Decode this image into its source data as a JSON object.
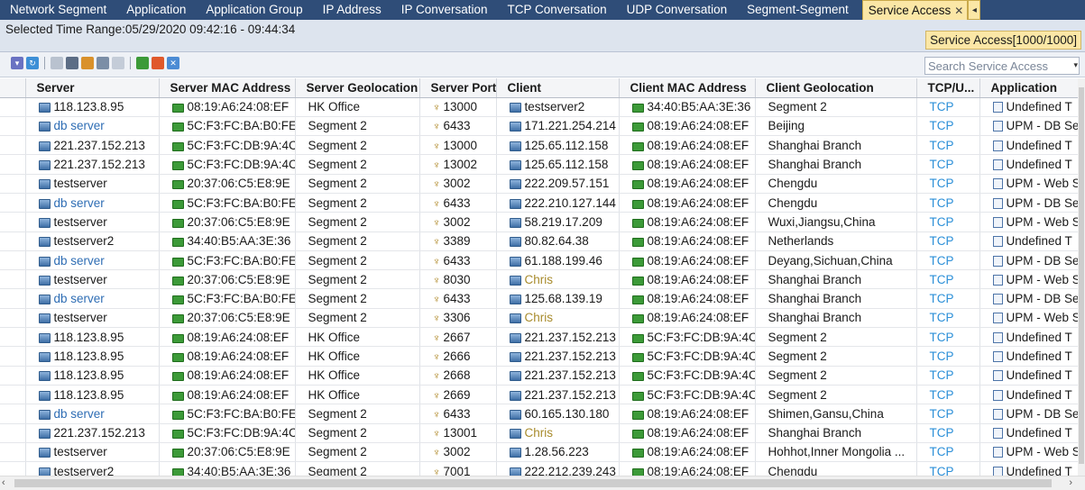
{
  "tabs": [
    {
      "label": "Network Segment",
      "active": false
    },
    {
      "label": "Application",
      "active": false
    },
    {
      "label": "Application Group",
      "active": false
    },
    {
      "label": "IP Address",
      "active": false
    },
    {
      "label": "IP Conversation",
      "active": false
    },
    {
      "label": "TCP Conversation",
      "active": false
    },
    {
      "label": "UDP Conversation",
      "active": false
    },
    {
      "label": "Segment-Segment",
      "active": false
    },
    {
      "label": "Service Access",
      "active": true
    }
  ],
  "info": {
    "time_range": "Selected Time Range:05/29/2020 09:42:16 - 09:44:34",
    "access_count": "Service Access[1000/1000]"
  },
  "search": {
    "placeholder": "Search Service Access"
  },
  "toolbar_icons": [
    "filter-icon",
    "refresh-icon",
    "columns-icon",
    "print-icon",
    "export-icon",
    "chart-icon",
    "settings-icon",
    "grid-icon",
    "pie-chart-icon",
    "clear-icon"
  ],
  "columns": [
    "Server",
    "Server MAC Address",
    "Server Geolocation",
    "Server Port",
    "Client",
    "Client MAC Address",
    "Client Geolocation",
    "TCP/U...",
    "Application"
  ],
  "rows": [
    {
      "server": "118.123.8.95",
      "server_link": false,
      "server_mac": "08:19:A6:24:08:EF",
      "server_geo": "HK Office",
      "port": "13000",
      "client": "testserver2",
      "client_link": "none",
      "client_mac": "34:40:B5:AA:3E:36",
      "client_geo": "Segment 2",
      "proto": "TCP",
      "app": "Undefined T"
    },
    {
      "server": "db server",
      "server_link": true,
      "server_mac": "5C:F3:FC:BA:B0:FE",
      "server_geo": "Segment 2",
      "port": "6433",
      "client": "171.221.254.214",
      "client_link": "none",
      "client_mac": "08:19:A6:24:08:EF",
      "client_geo": "Beijing",
      "proto": "TCP",
      "app": "UPM - DB Se"
    },
    {
      "server": "221.237.152.213",
      "server_link": false,
      "server_mac": "5C:F3:FC:DB:9A:4C",
      "server_geo": "Segment 2",
      "port": "13000",
      "client": "125.65.112.158",
      "client_link": "none",
      "client_mac": "08:19:A6:24:08:EF",
      "client_geo": "Shanghai Branch",
      "proto": "TCP",
      "app": "Undefined T"
    },
    {
      "server": "221.237.152.213",
      "server_link": false,
      "server_mac": "5C:F3:FC:DB:9A:4C",
      "server_geo": "Segment 2",
      "port": "13002",
      "client": "125.65.112.158",
      "client_link": "none",
      "client_mac": "08:19:A6:24:08:EF",
      "client_geo": "Shanghai Branch",
      "proto": "TCP",
      "app": "Undefined T"
    },
    {
      "server": "testserver",
      "server_link": false,
      "server_mac": "20:37:06:C5:E8:9E",
      "server_geo": "Segment 2",
      "port": "3002",
      "client": "222.209.57.151",
      "client_link": "none",
      "client_mac": "08:19:A6:24:08:EF",
      "client_geo": "Chengdu",
      "proto": "TCP",
      "app": "UPM - Web S"
    },
    {
      "server": "db server",
      "server_link": true,
      "server_mac": "5C:F3:FC:BA:B0:FE",
      "server_geo": "Segment 2",
      "port": "6433",
      "client": "222.210.127.144",
      "client_link": "none",
      "client_mac": "08:19:A6:24:08:EF",
      "client_geo": "Chengdu",
      "proto": "TCP",
      "app": "UPM - DB Se"
    },
    {
      "server": "testserver",
      "server_link": false,
      "server_mac": "20:37:06:C5:E8:9E",
      "server_geo": "Segment 2",
      "port": "3002",
      "client": "58.219.17.209",
      "client_link": "none",
      "client_mac": "08:19:A6:24:08:EF",
      "client_geo": "Wuxi,Jiangsu,China",
      "proto": "TCP",
      "app": "UPM - Web S"
    },
    {
      "server": "testserver2",
      "server_link": false,
      "server_mac": "34:40:B5:AA:3E:36",
      "server_geo": "Segment 2",
      "port": "3389",
      "client": "80.82.64.38",
      "client_link": "none",
      "client_mac": "08:19:A6:24:08:EF",
      "client_geo": "Netherlands",
      "proto": "TCP",
      "app": "Undefined T"
    },
    {
      "server": "db server",
      "server_link": true,
      "server_mac": "5C:F3:FC:BA:B0:FE",
      "server_geo": "Segment 2",
      "port": "6433",
      "client": "61.188.199.46",
      "client_link": "none",
      "client_mac": "08:19:A6:24:08:EF",
      "client_geo": "Deyang,Sichuan,China",
      "proto": "TCP",
      "app": "UPM - DB Se"
    },
    {
      "server": "testserver",
      "server_link": false,
      "server_mac": "20:37:06:C5:E8:9E",
      "server_geo": "Segment 2",
      "port": "8030",
      "client": "Chris",
      "client_link": "gold",
      "client_mac": "08:19:A6:24:08:EF",
      "client_geo": "Shanghai Branch",
      "proto": "TCP",
      "app": "UPM - Web S"
    },
    {
      "server": "db server",
      "server_link": true,
      "server_mac": "5C:F3:FC:BA:B0:FE",
      "server_geo": "Segment 2",
      "port": "6433",
      "client": "125.68.139.19",
      "client_link": "none",
      "client_mac": "08:19:A6:24:08:EF",
      "client_geo": "Shanghai Branch",
      "proto": "TCP",
      "app": "UPM - DB Se"
    },
    {
      "server": "testserver",
      "server_link": false,
      "server_mac": "20:37:06:C5:E8:9E",
      "server_geo": "Segment 2",
      "port": "3306",
      "client": "Chris",
      "client_link": "gold",
      "client_mac": "08:19:A6:24:08:EF",
      "client_geo": "Shanghai Branch",
      "proto": "TCP",
      "app": "UPM - Web S"
    },
    {
      "server": "118.123.8.95",
      "server_link": false,
      "server_mac": "08:19:A6:24:08:EF",
      "server_geo": "HK Office",
      "port": "2667",
      "client": "221.237.152.213",
      "client_link": "none",
      "client_mac": "5C:F3:FC:DB:9A:4C",
      "client_geo": "Segment 2",
      "proto": "TCP",
      "app": "Undefined T"
    },
    {
      "server": "118.123.8.95",
      "server_link": false,
      "server_mac": "08:19:A6:24:08:EF",
      "server_geo": "HK Office",
      "port": "2666",
      "client": "221.237.152.213",
      "client_link": "none",
      "client_mac": "5C:F3:FC:DB:9A:4C",
      "client_geo": "Segment 2",
      "proto": "TCP",
      "app": "Undefined T"
    },
    {
      "server": "118.123.8.95",
      "server_link": false,
      "server_mac": "08:19:A6:24:08:EF",
      "server_geo": "HK Office",
      "port": "2668",
      "client": "221.237.152.213",
      "client_link": "none",
      "client_mac": "5C:F3:FC:DB:9A:4C",
      "client_geo": "Segment 2",
      "proto": "TCP",
      "app": "Undefined T"
    },
    {
      "server": "118.123.8.95",
      "server_link": false,
      "server_mac": "08:19:A6:24:08:EF",
      "server_geo": "HK Office",
      "port": "2669",
      "client": "221.237.152.213",
      "client_link": "none",
      "client_mac": "5C:F3:FC:DB:9A:4C",
      "client_geo": "Segment 2",
      "proto": "TCP",
      "app": "Undefined T"
    },
    {
      "server": "db server",
      "server_link": true,
      "server_mac": "5C:F3:FC:BA:B0:FE",
      "server_geo": "Segment 2",
      "port": "6433",
      "client": "60.165.130.180",
      "client_link": "none",
      "client_mac": "08:19:A6:24:08:EF",
      "client_geo": "Shimen,Gansu,China",
      "proto": "TCP",
      "app": "UPM - DB Se"
    },
    {
      "server": "221.237.152.213",
      "server_link": false,
      "server_mac": "5C:F3:FC:DB:9A:4C",
      "server_geo": "Segment 2",
      "port": "13001",
      "client": "Chris",
      "client_link": "gold",
      "client_mac": "08:19:A6:24:08:EF",
      "client_geo": "Shanghai Branch",
      "proto": "TCP",
      "app": "Undefined T"
    },
    {
      "server": "testserver",
      "server_link": false,
      "server_mac": "20:37:06:C5:E8:9E",
      "server_geo": "Segment 2",
      "port": "3002",
      "client": "1.28.56.223",
      "client_link": "none",
      "client_mac": "08:19:A6:24:08:EF",
      "client_geo": "Hohhot,Inner Mongolia ...",
      "proto": "TCP",
      "app": "UPM - Web S"
    },
    {
      "server": "testserver2",
      "server_link": false,
      "server_mac": "34:40:B5:AA:3E:36",
      "server_geo": "Segment 2",
      "port": "7001",
      "client": "222.212.239.243",
      "client_link": "none",
      "client_mac": "08:19:A6:24:08:EF",
      "client_geo": "Chengdu",
      "proto": "TCP",
      "app": "Undefined T"
    }
  ],
  "colors": {
    "tab_bar": "#2f4d78",
    "active_tab": "#fbe7a6",
    "link_blue": "#2e6db4",
    "link_gold": "#a88b2c",
    "protocol": "#2b8fd8"
  }
}
